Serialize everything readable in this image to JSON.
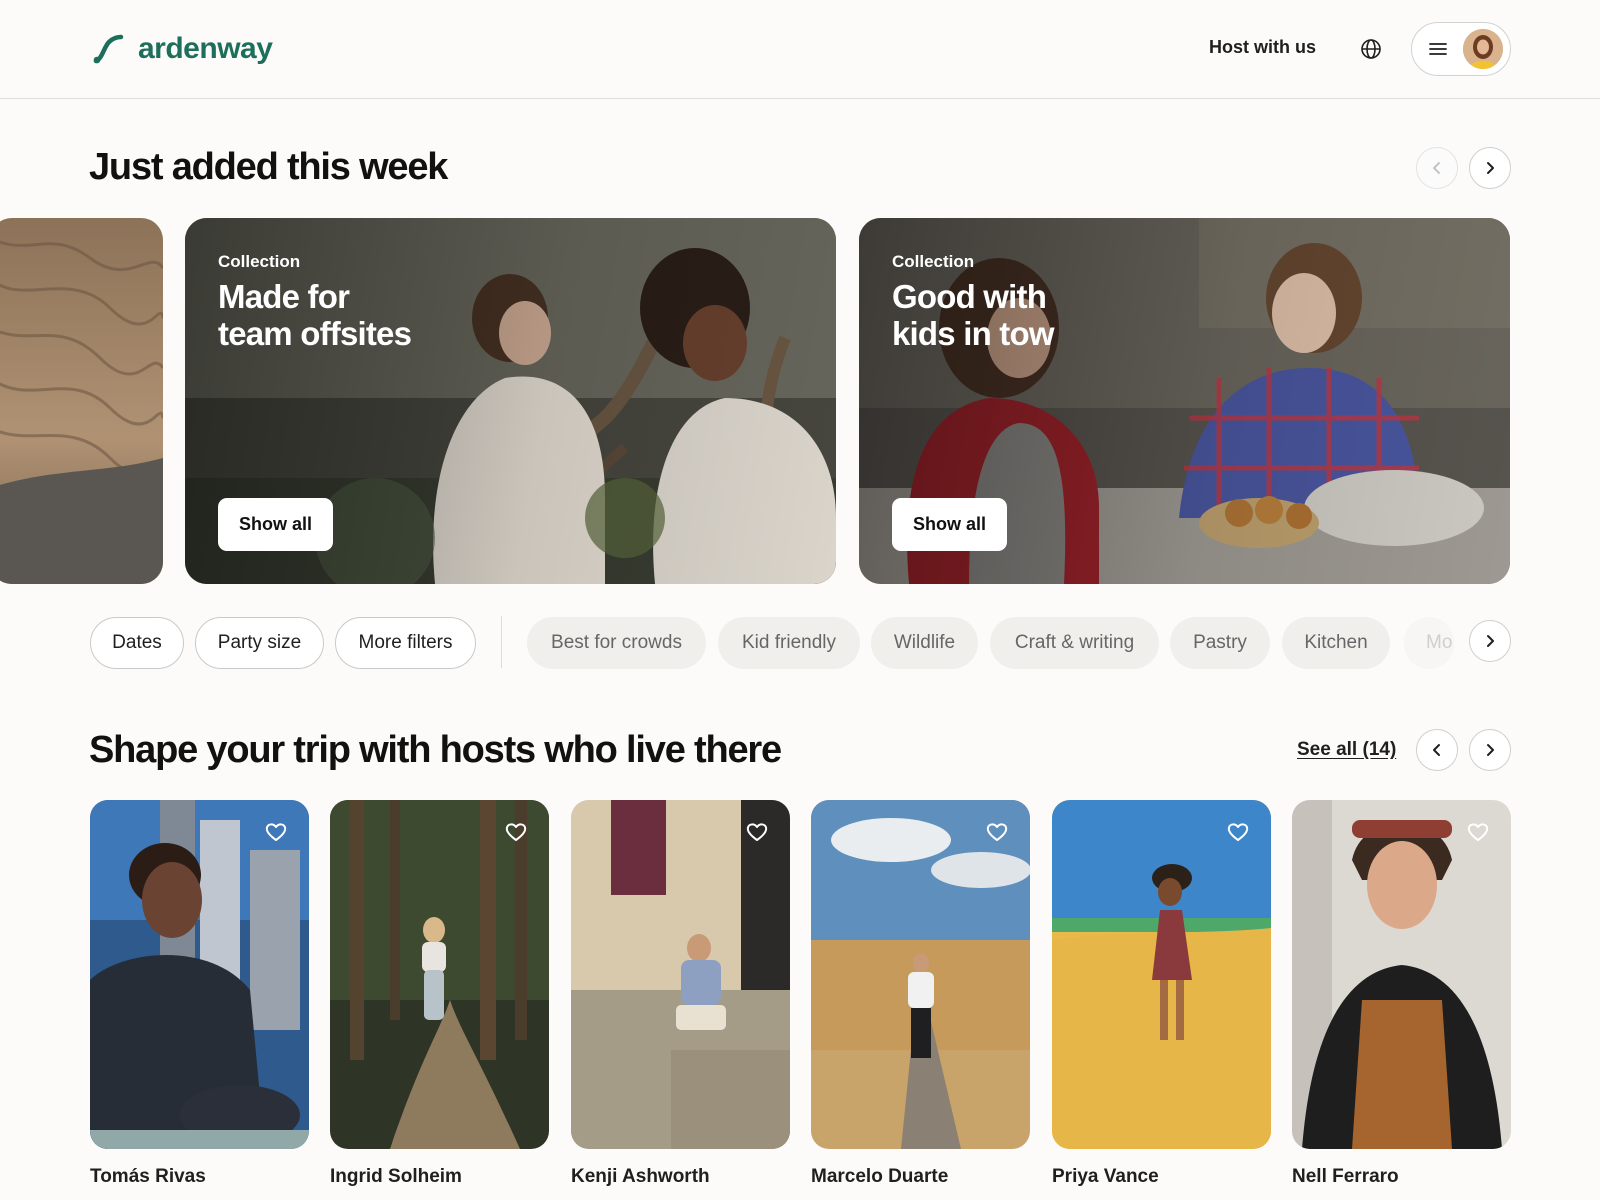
{
  "brand": {
    "name": "ardenway",
    "color": "#1e6e5c"
  },
  "header": {
    "host_link": "Host with us",
    "globe_icon": "globe-icon",
    "menu_icon": "hamburger-menu-icon",
    "avatar": "user-avatar"
  },
  "just_added": {
    "title": "Just added this week",
    "cards": [
      {
        "kicker": "Collection",
        "title": "Made for\nteam offsites",
        "button": "Show all"
      },
      {
        "kicker": "Collection",
        "title": "Good with\nkids in tow",
        "button": "Show all"
      }
    ]
  },
  "filters": {
    "primary": [
      "Dates",
      "Party size",
      "More filters"
    ],
    "categories": [
      "Best for crowds",
      "Kid friendly",
      "Wildlife",
      "Craft & writing",
      "Pastry",
      "Kitchen",
      "Mo"
    ]
  },
  "hosts": {
    "title": "Shape your trip with hosts who live there",
    "see_all": "See all (14)",
    "items": [
      {
        "name": "Tomás Rivas"
      },
      {
        "name": "Ingrid Solheim"
      },
      {
        "name": "Kenji Ashworth"
      },
      {
        "name": "Marcelo Duarte"
      },
      {
        "name": "Priya Vance"
      },
      {
        "name": "Nell Ferraro"
      }
    ]
  },
  "colors": {
    "accent": "#1e6e5c",
    "text": "#1f1f1f",
    "chip_soft": "#f1efec"
  }
}
